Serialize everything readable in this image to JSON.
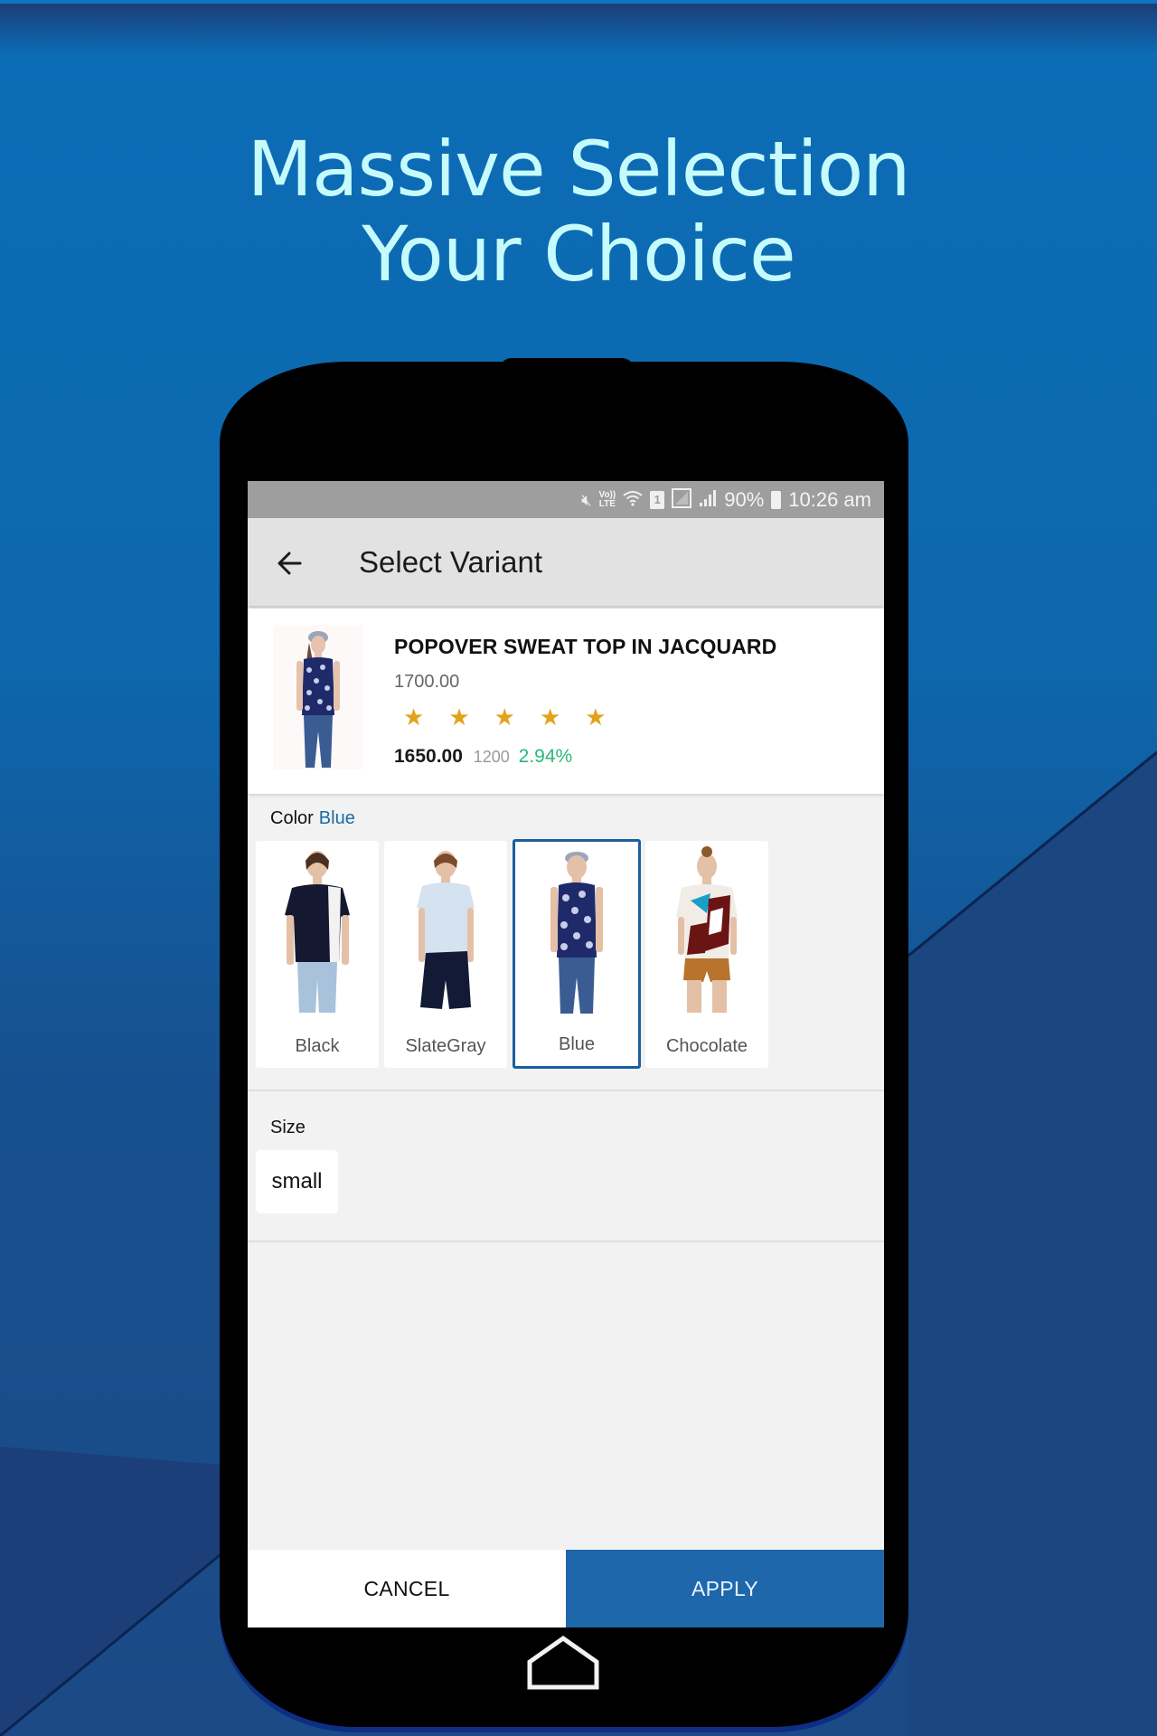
{
  "promo": {
    "headline_line1": "Massive Selection",
    "headline_line2": "Your Choice",
    "headline_color": "#c6fbfc"
  },
  "status_bar": {
    "icons": [
      "mute-icon",
      "volte-lte-icon",
      "wifi-icon",
      "sim-1-icon",
      "signal-icon",
      "signal-bars-icon",
      "battery-icon"
    ],
    "volte_label": "Vo)) LTE",
    "sim_label": "1",
    "battery": "90%",
    "time": "10:26 am"
  },
  "app_bar": {
    "back_icon": "arrow-left-icon",
    "title": "Select Variant"
  },
  "product": {
    "name": "POPOVER SWEAT TOP IN JACQUARD",
    "mrp": "1700.00",
    "rating": 5,
    "rating_max": 5,
    "price": "1650.00",
    "old_price": "1200",
    "discount": "2.94%",
    "star_color": "#e2a31a",
    "discount_color": "#2db67c"
  },
  "color": {
    "label": "Color",
    "selected": "Blue",
    "options": [
      {
        "label": "Black",
        "selected": false
      },
      {
        "label": "SlateGray",
        "selected": false
      },
      {
        "label": "Blue",
        "selected": true
      },
      {
        "label": "Chocolate",
        "selected": false
      }
    ]
  },
  "size": {
    "label": "Size",
    "options": [
      {
        "label": "small"
      }
    ]
  },
  "actions": {
    "cancel": "CANCEL",
    "apply": "APPLY",
    "accent": "#1f67ab"
  },
  "nav": {
    "home_icon": "home-icon"
  }
}
